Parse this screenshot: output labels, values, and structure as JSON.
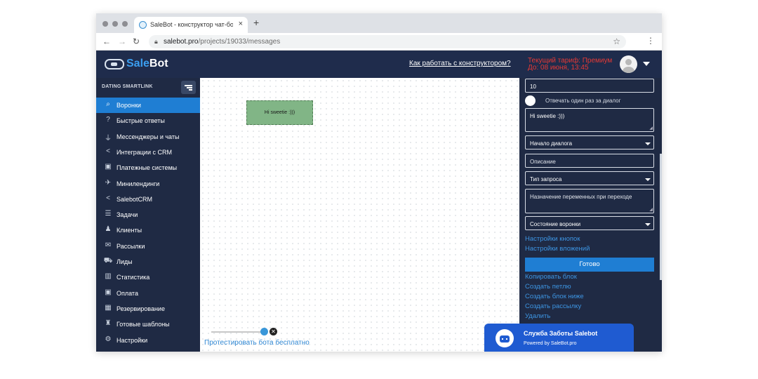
{
  "browser": {
    "tab_title": "SaleBot - конструктор чат-бо",
    "tab_close": "×",
    "new_tab": "+",
    "url_host": "salebot.pro",
    "url_path": "/projects/19033/messages"
  },
  "header": {
    "logo_sale": "Sale",
    "logo_bot": "Bot",
    "howto_link": "Как работать с конструктором?",
    "tariff_line1": "Текущий тариф: Премиум",
    "tariff_line2": "До: 08 июня, 13:45"
  },
  "sidebar": {
    "project_name": "DATING SMARTLINK",
    "items": [
      {
        "label": "Воронки",
        "icon": "chat-bubbles-icon",
        "glyph": "⌕",
        "active": true
      },
      {
        "label": "Быстрые ответы",
        "icon": "question-icon",
        "glyph": "?"
      },
      {
        "label": "Мессенджеры и чаты",
        "icon": "plug-icon",
        "glyph": "⏚"
      },
      {
        "label": "Интеграции с CRM",
        "icon": "share-icon",
        "glyph": "<"
      },
      {
        "label": "Платежные системы",
        "icon": "money-icon",
        "glyph": "▣"
      },
      {
        "label": "Минилендинги",
        "icon": "plane-icon",
        "glyph": "✈"
      },
      {
        "label": "SalebotCRM",
        "icon": "share-icon",
        "glyph": "<"
      },
      {
        "label": "Задачи",
        "icon": "tasks-icon",
        "glyph": "☰"
      },
      {
        "label": "Клиенты",
        "icon": "users-icon",
        "glyph": "♟"
      },
      {
        "label": "Рассылки",
        "icon": "envelope-icon",
        "glyph": "✉"
      },
      {
        "label": "Лиды",
        "icon": "cart-icon",
        "glyph": "⛟"
      },
      {
        "label": "Статистика",
        "icon": "chart-icon",
        "glyph": "▥"
      },
      {
        "label": "Оплата",
        "icon": "money-icon",
        "glyph": "▣"
      },
      {
        "label": "Резервирование",
        "icon": "boxes-icon",
        "glyph": "▦"
      },
      {
        "label": "Готовые шаблоны",
        "icon": "sitemap-icon",
        "glyph": "♜"
      },
      {
        "label": "Настройки",
        "icon": "gears-icon",
        "glyph": "⚙"
      }
    ]
  },
  "canvas": {
    "block_text": "Hi sweetie :)))",
    "test_link": "Протестировать бота бесплатно"
  },
  "panel": {
    "delay_value": "10",
    "reply_once_label": "Отвечать один раз за диалог",
    "message_text": "Hi sweetie :)))",
    "dialog_select": "Начало диалога",
    "description_placeholder": "Описание",
    "request_type_select": "Тип запроса",
    "vars_placeholder": "Назначение переменных при переходе",
    "funnel_state_select": "Состояние воронки",
    "button_settings_link": "Настройки кнопок",
    "attachment_settings_link": "Настройки вложений",
    "done_button": "Готово",
    "copy_block_link": "Копировать блок",
    "create_loop_link": "Создать петлю",
    "create_below_link": "Создать блок ниже",
    "create_broadcast_link": "Создать рассылку",
    "delete_link": "Удалить"
  },
  "support": {
    "title": "Служба Заботы Salebot",
    "subtitle": "Powered by SaleBot.pro"
  },
  "colors": {
    "header_bg": "#1f2c4c",
    "sidebar_bg": "#1f2a44",
    "accent": "#1f7ed3",
    "tariff_red": "#e53935",
    "block_green": "#81b586"
  }
}
